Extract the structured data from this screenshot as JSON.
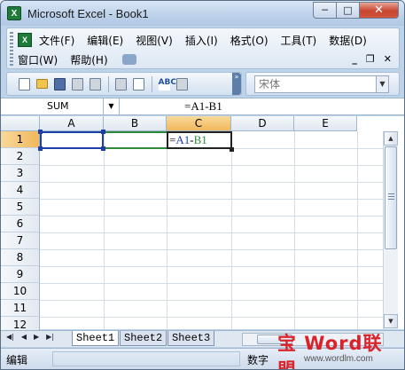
{
  "window": {
    "title": "Microsoft Excel - Book1",
    "app_icon_letter": "X",
    "min_glyph": "─",
    "max_glyph": "□",
    "close_glyph": "✕"
  },
  "menubar": {
    "doc_icon_letter": "X",
    "row1": [
      "文件(F)",
      "编辑(E)",
      "视图(V)",
      "插入(I)",
      "格式(O)",
      "工具(T)",
      "数据(D)"
    ],
    "row2": [
      "窗口(W)",
      "帮助(H)"
    ],
    "mdi": {
      "min": "_",
      "restore": "❐",
      "close": "✕"
    }
  },
  "toolbar": {
    "font_name": "宋体",
    "spell_label": "ABC"
  },
  "formulabar": {
    "name_box": "SUM",
    "formula": "=A1-B1"
  },
  "grid": {
    "columns": [
      "A",
      "B",
      "C",
      "D",
      "E"
    ],
    "active_column": "C",
    "rows": [
      "1",
      "2",
      "3",
      "4",
      "5",
      "6",
      "7",
      "8",
      "9",
      "10",
      "11",
      "12"
    ],
    "active_row": "1",
    "cell_c1": {
      "eq": "=",
      "ref1": "A1",
      "minus": "-",
      "ref2": "B1"
    }
  },
  "sheets": {
    "tabs": [
      "Sheet1",
      "Sheet2",
      "Sheet3"
    ],
    "active": "Sheet1"
  },
  "status": {
    "mode": "编辑",
    "numlock": "数字"
  },
  "watermark": {
    "main": "宝 Word联盟",
    "url": "www.wordlm.com"
  },
  "colors": {
    "ref_a1": "#1f3fa8",
    "ref_b1": "#2e8b3c",
    "active_header": "#f1b75b"
  }
}
